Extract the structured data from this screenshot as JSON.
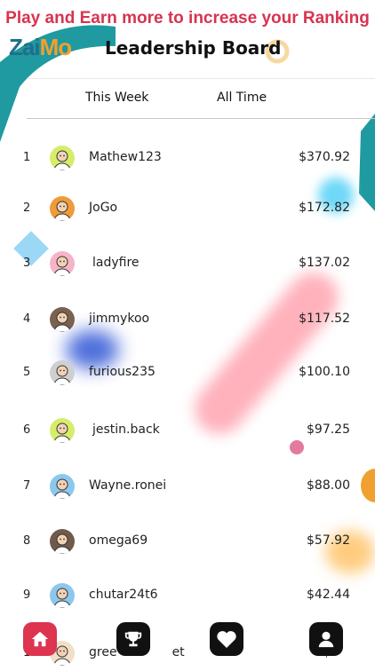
{
  "banner": "Play and Earn more to increase your Ranking",
  "logo": {
    "part1": "Zai",
    "part2": "Mo"
  },
  "title": "Leadership Board",
  "tabs": [
    "This Week",
    "All Time"
  ],
  "leaders": [
    {
      "rank": "1",
      "name": "Mathew123",
      "amount": "$370.92",
      "avatar_color": "#d4ee6a"
    },
    {
      "rank": "2",
      "name": "JoGo",
      "amount": "$172.82",
      "avatar_color": "#f19a3a"
    },
    {
      "rank": "3",
      "name": "ladyfire",
      "amount": "$137.02",
      "avatar_color": "#f7b4c8"
    },
    {
      "rank": "4",
      "name": "jimmykoo",
      "amount": "$117.52",
      "avatar_color": "#7a6150"
    },
    {
      "rank": "5",
      "name": "furious235",
      "amount": "$100.10",
      "avatar_color": "#cfcfcf"
    },
    {
      "rank": "6",
      "name": "jestin.back",
      "amount": "$97.25",
      "avatar_color": "#d4ee6a"
    },
    {
      "rank": "7",
      "name": "Wayne.ronei",
      "amount": "$88.00",
      "avatar_color": "#8cc8ee"
    },
    {
      "rank": "8",
      "name": "omega69",
      "amount": "$57.92",
      "avatar_color": "#6f5a4c"
    },
    {
      "rank": "9",
      "name": "chutar24t6",
      "amount": "$42.44",
      "avatar_color": "#8cc8ee"
    },
    {
      "rank": "1",
      "name": "gree",
      "name_tail": "et",
      "amount": "$",
      "avatar_color": "#f0e0c8"
    }
  ],
  "nav": [
    {
      "icon": "home-icon"
    },
    {
      "icon": "trophy-icon"
    },
    {
      "icon": "heart-icon"
    },
    {
      "icon": "user-icon"
    }
  ],
  "colors": {
    "accent": "#dd3450",
    "teal": "#1f9aa0",
    "orange": "#f0a030"
  }
}
